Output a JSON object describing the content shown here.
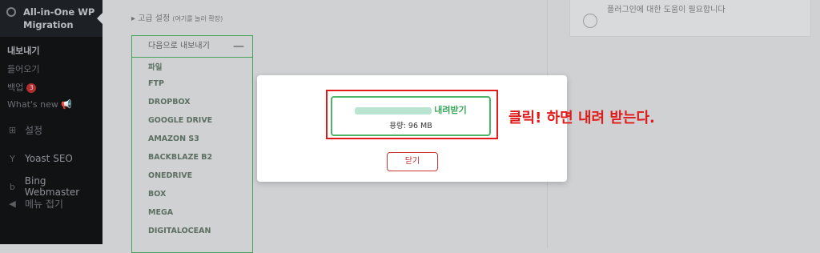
{
  "sidebar": {
    "plugin_title": "All-in-One WP Migration",
    "items": [
      {
        "label": "내보내기",
        "active": true
      },
      {
        "label": "들어오기"
      },
      {
        "label": "백업",
        "badge": "3"
      },
      {
        "label": "What's new 📢"
      }
    ],
    "menu": [
      {
        "label": "설정",
        "icon": "settings-icon"
      },
      {
        "label": "Yoast SEO",
        "icon": "yoast-icon"
      },
      {
        "label": "Bing Webmaster",
        "icon": "bing-icon"
      },
      {
        "label": "메뉴 접기",
        "icon": "collapse-icon"
      }
    ]
  },
  "advanced": {
    "label": "고급 설정",
    "hint": "(여기를 눌러 확장)"
  },
  "export_menu": {
    "header": "다음으로 내보내기",
    "toggle": "—",
    "options": [
      "파일",
      "FTP",
      "DROPBOX",
      "GOOGLE DRIVE",
      "AMAZON S3",
      "BACKBLAZE B2",
      "ONEDRIVE",
      "BOX",
      "MEGA",
      "DIGITALOCEAN"
    ]
  },
  "help": {
    "text": "플러그인에 대한 도움이 필요합니다"
  },
  "modal": {
    "download_label": "내려받기",
    "size_text": "용량: 96 MB",
    "close_label": "닫기"
  },
  "annotation": {
    "text": "클릭! 하면 내려 받는다."
  },
  "colors": {
    "accent_green": "#4cb567",
    "annotation_red": "#e21a1a",
    "sidebar_bg": "#101214"
  }
}
